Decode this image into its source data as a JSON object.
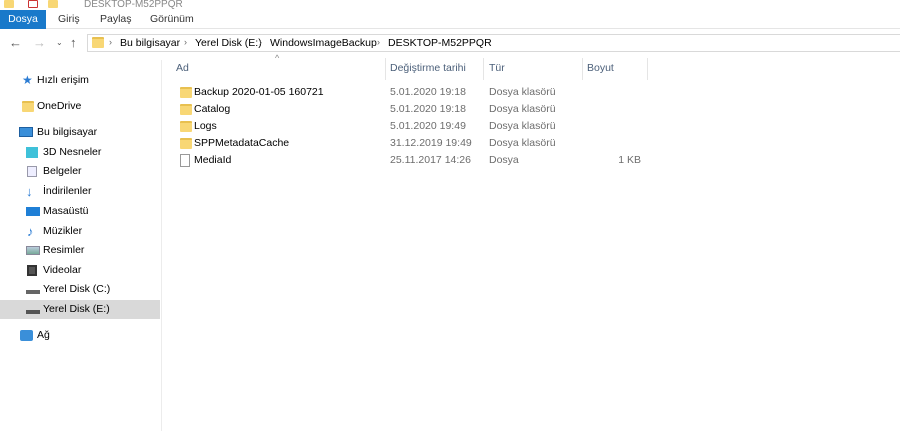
{
  "window": {
    "title": "DESKTOP-M52PPQR"
  },
  "ribbon": {
    "tabs": [
      "Dosya",
      "Giriş",
      "Paylaş",
      "Görünüm"
    ]
  },
  "address": {
    "crumbs": [
      "Bu bilgisayar",
      "Yerel Disk (E:)",
      "WindowsImageBackup",
      "DESKTOP-M52PPQR"
    ]
  },
  "sidebar": {
    "items": [
      {
        "label": "Hızlı erişim",
        "icon": "star-icon"
      },
      {
        "label": "OneDrive",
        "icon": "onedrive-folder-icon"
      },
      {
        "label": "Bu bilgisayar",
        "icon": "computer-icon"
      },
      {
        "label": "3D Nesneler",
        "icon": "3d-objects-icon"
      },
      {
        "label": "Belgeler",
        "icon": "documents-icon"
      },
      {
        "label": "İndirilenler",
        "icon": "downloads-icon"
      },
      {
        "label": "Masaüstü",
        "icon": "desktop-icon"
      },
      {
        "label": "Müzikler",
        "icon": "music-icon"
      },
      {
        "label": "Resimler",
        "icon": "pictures-icon"
      },
      {
        "label": "Videolar",
        "icon": "videos-icon"
      },
      {
        "label": "Yerel Disk (C:)",
        "icon": "drive-c-icon"
      },
      {
        "label": "Yerel Disk (E:)",
        "icon": "drive-e-icon"
      },
      {
        "label": "Ağ",
        "icon": "network-icon"
      }
    ]
  },
  "columns": [
    "Ad",
    "Değiştirme tarihi",
    "Tür",
    "Boyut"
  ],
  "files": [
    {
      "name": "Backup 2020-01-05 160721",
      "date": "5.01.2020 19:18",
      "type": "Dosya klasörü",
      "size": "",
      "kind": "folder"
    },
    {
      "name": "Catalog",
      "date": "5.01.2020 19:18",
      "type": "Dosya klasörü",
      "size": "",
      "kind": "folder"
    },
    {
      "name": "Logs",
      "date": "5.01.2020 19:49",
      "type": "Dosya klasörü",
      "size": "",
      "kind": "folder"
    },
    {
      "name": "SPPMetadataCache",
      "date": "31.12.2019 19:49",
      "type": "Dosya klasörü",
      "size": "",
      "kind": "folder"
    },
    {
      "name": "MediaId",
      "date": "25.11.2017 14:26",
      "type": "Dosya",
      "size": "1 KB",
      "kind": "file"
    }
  ]
}
